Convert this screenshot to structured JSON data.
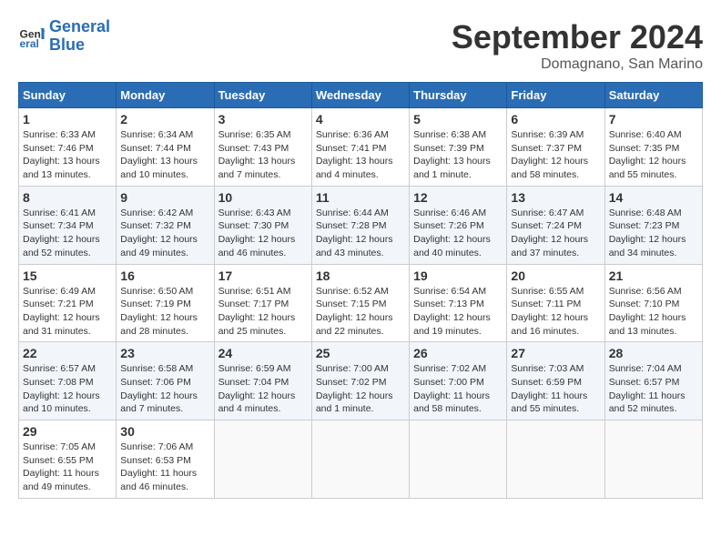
{
  "header": {
    "logo_line1": "General",
    "logo_line2": "Blue",
    "month_title": "September 2024",
    "subtitle": "Domagnano, San Marino"
  },
  "weekdays": [
    "Sunday",
    "Monday",
    "Tuesday",
    "Wednesday",
    "Thursday",
    "Friday",
    "Saturday"
  ],
  "weeks": [
    [
      {
        "day": "1",
        "info": "Sunrise: 6:33 AM\nSunset: 7:46 PM\nDaylight: 13 hours\nand 13 minutes."
      },
      {
        "day": "2",
        "info": "Sunrise: 6:34 AM\nSunset: 7:44 PM\nDaylight: 13 hours\nand 10 minutes."
      },
      {
        "day": "3",
        "info": "Sunrise: 6:35 AM\nSunset: 7:43 PM\nDaylight: 13 hours\nand 7 minutes."
      },
      {
        "day": "4",
        "info": "Sunrise: 6:36 AM\nSunset: 7:41 PM\nDaylight: 13 hours\nand 4 minutes."
      },
      {
        "day": "5",
        "info": "Sunrise: 6:38 AM\nSunset: 7:39 PM\nDaylight: 13 hours\nand 1 minute."
      },
      {
        "day": "6",
        "info": "Sunrise: 6:39 AM\nSunset: 7:37 PM\nDaylight: 12 hours\nand 58 minutes."
      },
      {
        "day": "7",
        "info": "Sunrise: 6:40 AM\nSunset: 7:35 PM\nDaylight: 12 hours\nand 55 minutes."
      }
    ],
    [
      {
        "day": "8",
        "info": "Sunrise: 6:41 AM\nSunset: 7:34 PM\nDaylight: 12 hours\nand 52 minutes."
      },
      {
        "day": "9",
        "info": "Sunrise: 6:42 AM\nSunset: 7:32 PM\nDaylight: 12 hours\nand 49 minutes."
      },
      {
        "day": "10",
        "info": "Sunrise: 6:43 AM\nSunset: 7:30 PM\nDaylight: 12 hours\nand 46 minutes."
      },
      {
        "day": "11",
        "info": "Sunrise: 6:44 AM\nSunset: 7:28 PM\nDaylight: 12 hours\nand 43 minutes."
      },
      {
        "day": "12",
        "info": "Sunrise: 6:46 AM\nSunset: 7:26 PM\nDaylight: 12 hours\nand 40 minutes."
      },
      {
        "day": "13",
        "info": "Sunrise: 6:47 AM\nSunset: 7:24 PM\nDaylight: 12 hours\nand 37 minutes."
      },
      {
        "day": "14",
        "info": "Sunrise: 6:48 AM\nSunset: 7:23 PM\nDaylight: 12 hours\nand 34 minutes."
      }
    ],
    [
      {
        "day": "15",
        "info": "Sunrise: 6:49 AM\nSunset: 7:21 PM\nDaylight: 12 hours\nand 31 minutes."
      },
      {
        "day": "16",
        "info": "Sunrise: 6:50 AM\nSunset: 7:19 PM\nDaylight: 12 hours\nand 28 minutes."
      },
      {
        "day": "17",
        "info": "Sunrise: 6:51 AM\nSunset: 7:17 PM\nDaylight: 12 hours\nand 25 minutes."
      },
      {
        "day": "18",
        "info": "Sunrise: 6:52 AM\nSunset: 7:15 PM\nDaylight: 12 hours\nand 22 minutes."
      },
      {
        "day": "19",
        "info": "Sunrise: 6:54 AM\nSunset: 7:13 PM\nDaylight: 12 hours\nand 19 minutes."
      },
      {
        "day": "20",
        "info": "Sunrise: 6:55 AM\nSunset: 7:11 PM\nDaylight: 12 hours\nand 16 minutes."
      },
      {
        "day": "21",
        "info": "Sunrise: 6:56 AM\nSunset: 7:10 PM\nDaylight: 12 hours\nand 13 minutes."
      }
    ],
    [
      {
        "day": "22",
        "info": "Sunrise: 6:57 AM\nSunset: 7:08 PM\nDaylight: 12 hours\nand 10 minutes."
      },
      {
        "day": "23",
        "info": "Sunrise: 6:58 AM\nSunset: 7:06 PM\nDaylight: 12 hours\nand 7 minutes."
      },
      {
        "day": "24",
        "info": "Sunrise: 6:59 AM\nSunset: 7:04 PM\nDaylight: 12 hours\nand 4 minutes."
      },
      {
        "day": "25",
        "info": "Sunrise: 7:00 AM\nSunset: 7:02 PM\nDaylight: 12 hours\nand 1 minute."
      },
      {
        "day": "26",
        "info": "Sunrise: 7:02 AM\nSunset: 7:00 PM\nDaylight: 11 hours\nand 58 minutes."
      },
      {
        "day": "27",
        "info": "Sunrise: 7:03 AM\nSunset: 6:59 PM\nDaylight: 11 hours\nand 55 minutes."
      },
      {
        "day": "28",
        "info": "Sunrise: 7:04 AM\nSunset: 6:57 PM\nDaylight: 11 hours\nand 52 minutes."
      }
    ],
    [
      {
        "day": "29",
        "info": "Sunrise: 7:05 AM\nSunset: 6:55 PM\nDaylight: 11 hours\nand 49 minutes."
      },
      {
        "day": "30",
        "info": "Sunrise: 7:06 AM\nSunset: 6:53 PM\nDaylight: 11 hours\nand 46 minutes."
      },
      {
        "day": "",
        "info": ""
      },
      {
        "day": "",
        "info": ""
      },
      {
        "day": "",
        "info": ""
      },
      {
        "day": "",
        "info": ""
      },
      {
        "day": "",
        "info": ""
      }
    ]
  ]
}
